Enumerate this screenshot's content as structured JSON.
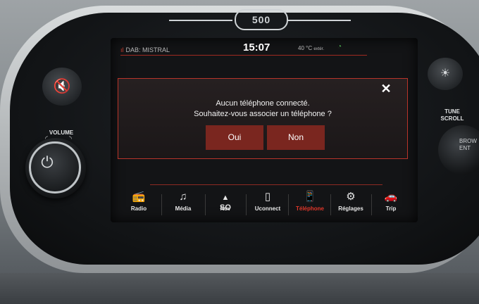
{
  "logo": "500",
  "status": {
    "source": "DAB: MISTRAL",
    "clock": "15:07",
    "temperature": "40 °C",
    "temperature_suffix": "extér."
  },
  "dialog": {
    "line1": "Aucun téléphone connecté.",
    "line2": "Souhaitez-vous associer un téléphone ?",
    "yes_label": "Oui",
    "no_label": "Non",
    "close_glyph": "✕"
  },
  "nav": {
    "radio": "Radio",
    "media": "Média",
    "nav": "Nav",
    "nav_heading": "SO",
    "uconnect": "Uconnect",
    "telephone": "Téléphone",
    "settings": "Réglages",
    "trip": "Trip"
  },
  "hardware": {
    "volume_label": "VOLUME",
    "tune_label_1": "TUNE",
    "tune_label_2": "SCROLL",
    "knob_right_1": "BROW",
    "knob_right_2": "ENT"
  },
  "colors": {
    "accent_red": "#e0372a",
    "button_red": "#7a261f",
    "eco_green": "#4caf50"
  },
  "icons": [
    "antenna-icon",
    "close-icon",
    "radio-icon",
    "media-icon",
    "compass-icon",
    "uconnect-icon",
    "phone-icon",
    "settings-icon",
    "trip-icon",
    "mute-icon",
    "brightness-icon",
    "power-icon",
    "eco-icon"
  ]
}
